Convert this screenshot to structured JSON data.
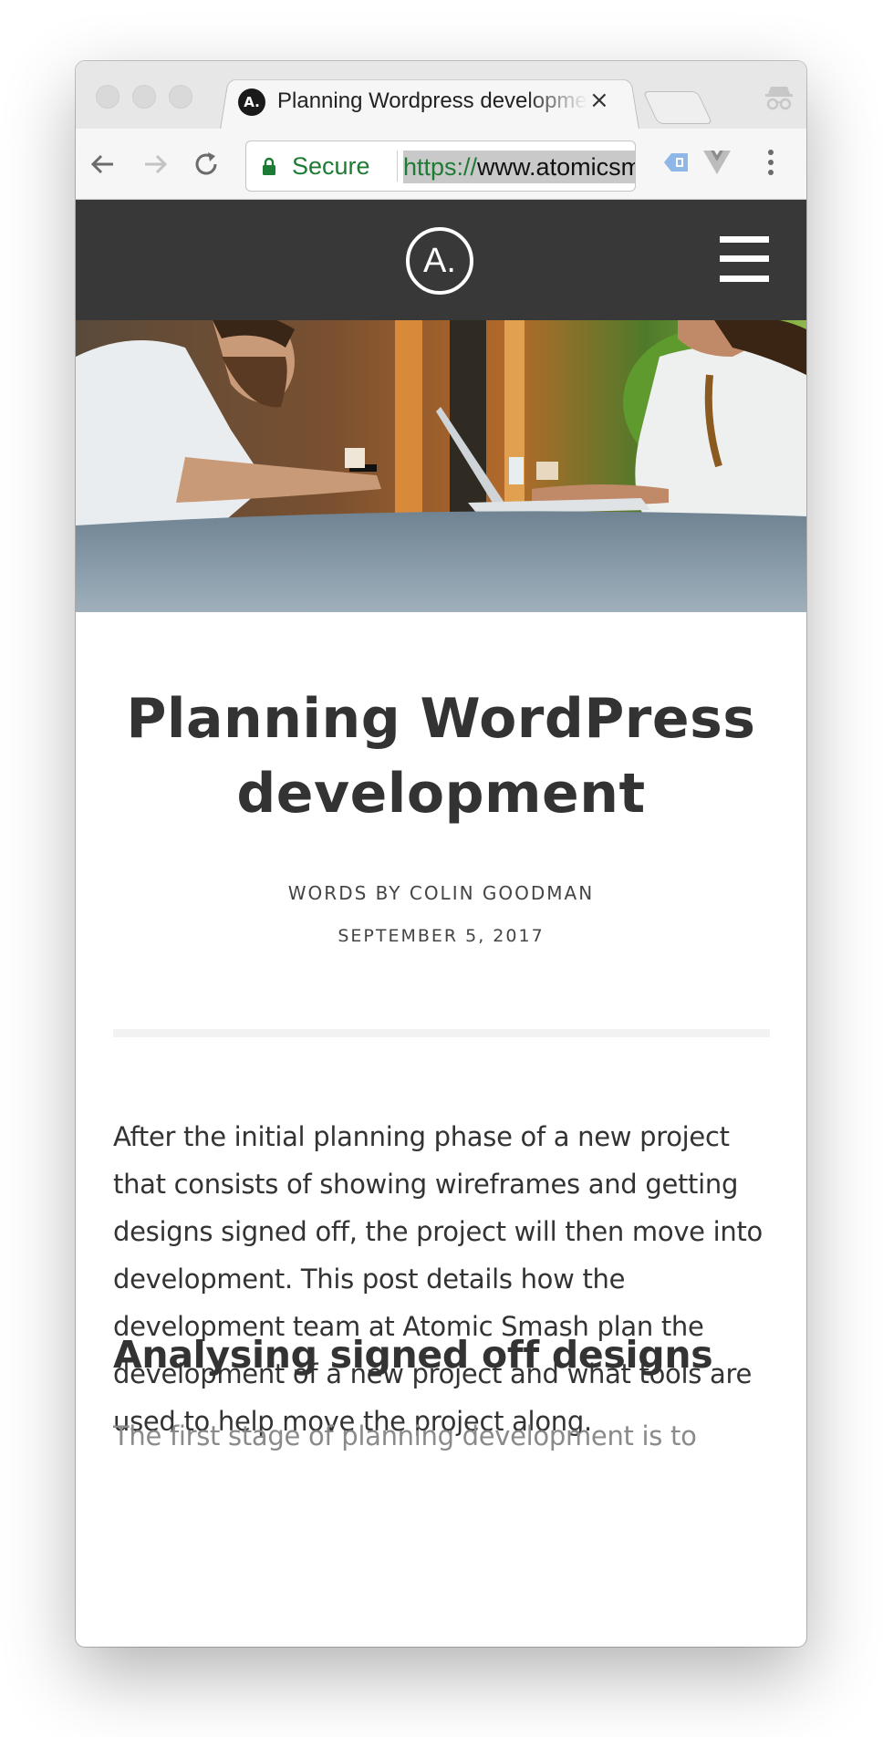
{
  "browser": {
    "tab": {
      "favicon_letter": "A.",
      "title": "Planning Wordpress development",
      "close_glyph": "×"
    },
    "toolbar": {
      "back_icon": "arrow-left-icon",
      "forward_icon": "arrow-right-icon",
      "reload_icon": "reload-icon",
      "secure_label": "Secure",
      "url_scheme": "https://",
      "url_host": "www.atomicsmash.co.uk",
      "extensions": [
        "translate-icon",
        "vue-devtools-icon"
      ],
      "menu_icon": "kebab-menu-icon"
    }
  },
  "site": {
    "logo_text": "A.",
    "menu_icon": "hamburger-icon",
    "header_color": "#383838"
  },
  "hero": {
    "image": "two people working at a cafe table with laptop and phone"
  },
  "article": {
    "title": "Planning WordPress development",
    "byline": "WORDS BY COLIN GOODMAN",
    "date": "SEPTEMBER 5, 2017",
    "intro": "After the initial planning phase of a new project that consists of showing wireframes and getting designs signed off, the project will then move into development. This post details how the development team at Atomic Smash plan the development of a new project and what tools are used to help move the project along.",
    "section_heading": "Analysing signed off designs",
    "section_text": "The first stage of planning development is to"
  }
}
